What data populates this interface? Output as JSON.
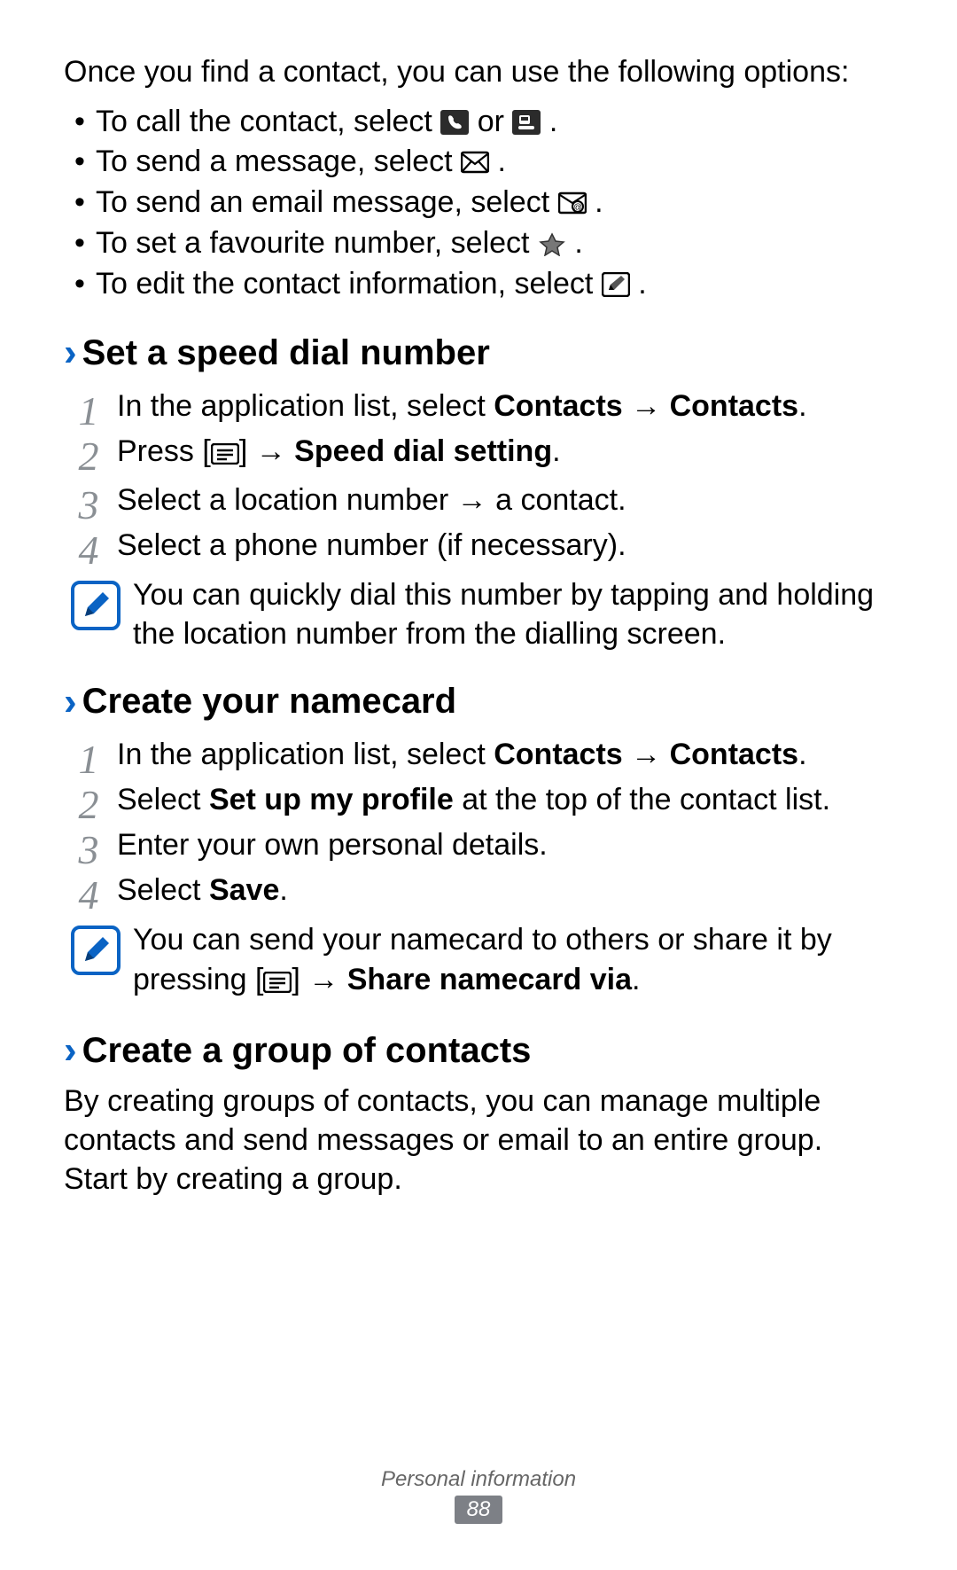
{
  "intro": "Once you find a contact, you can use the following options:",
  "bullets": {
    "b1a": "To call the contact, select ",
    "b1b": " or ",
    "b1c": ".",
    "b2a": "To send a message, select ",
    "b2b": ".",
    "b3a": "To send an email message, select ",
    "b3b": ".",
    "b4a": "To set a favourite number, select ",
    "b4b": ".",
    "b5a": "To edit the contact information, select ",
    "b5b": "."
  },
  "section1": {
    "title": "Set a speed dial number",
    "steps": {
      "s1a": "In the application list, select ",
      "s1b": "Contacts",
      "s1c": " → ",
      "s1d": "Contacts",
      "s1e": ".",
      "s2a": "Press [",
      "s2b": "] → ",
      "s2c": "Speed dial setting",
      "s2d": ".",
      "s3": "Select a location number → a contact.",
      "s4": "Select a phone number (if necessary)."
    },
    "note": "You can quickly dial this number by tapping and holding the location number from the dialling screen."
  },
  "section2": {
    "title": "Create your namecard",
    "steps": {
      "s1a": "In the application list, select ",
      "s1b": "Contacts",
      "s1c": " → ",
      "s1d": "Contacts",
      "s1e": ".",
      "s2a": "Select ",
      "s2b": "Set up my profile",
      "s2c": " at the top of the contact list.",
      "s3": "Enter your own personal details.",
      "s4a": "Select ",
      "s4b": "Save",
      "s4c": "."
    },
    "note_a": "You can send your namecard to others or share it by pressing [",
    "note_b": "] → ",
    "note_c": "Share namecard via",
    "note_d": "."
  },
  "section3": {
    "title": "Create a group of contacts",
    "body": "By creating groups of contacts, you can manage multiple contacts and send messages or email to an entire group. Start by creating a group."
  },
  "footer": {
    "section": "Personal information",
    "page": "88"
  },
  "numbers": {
    "n1": "1",
    "n2": "2",
    "n3": "3",
    "n4": "4"
  }
}
